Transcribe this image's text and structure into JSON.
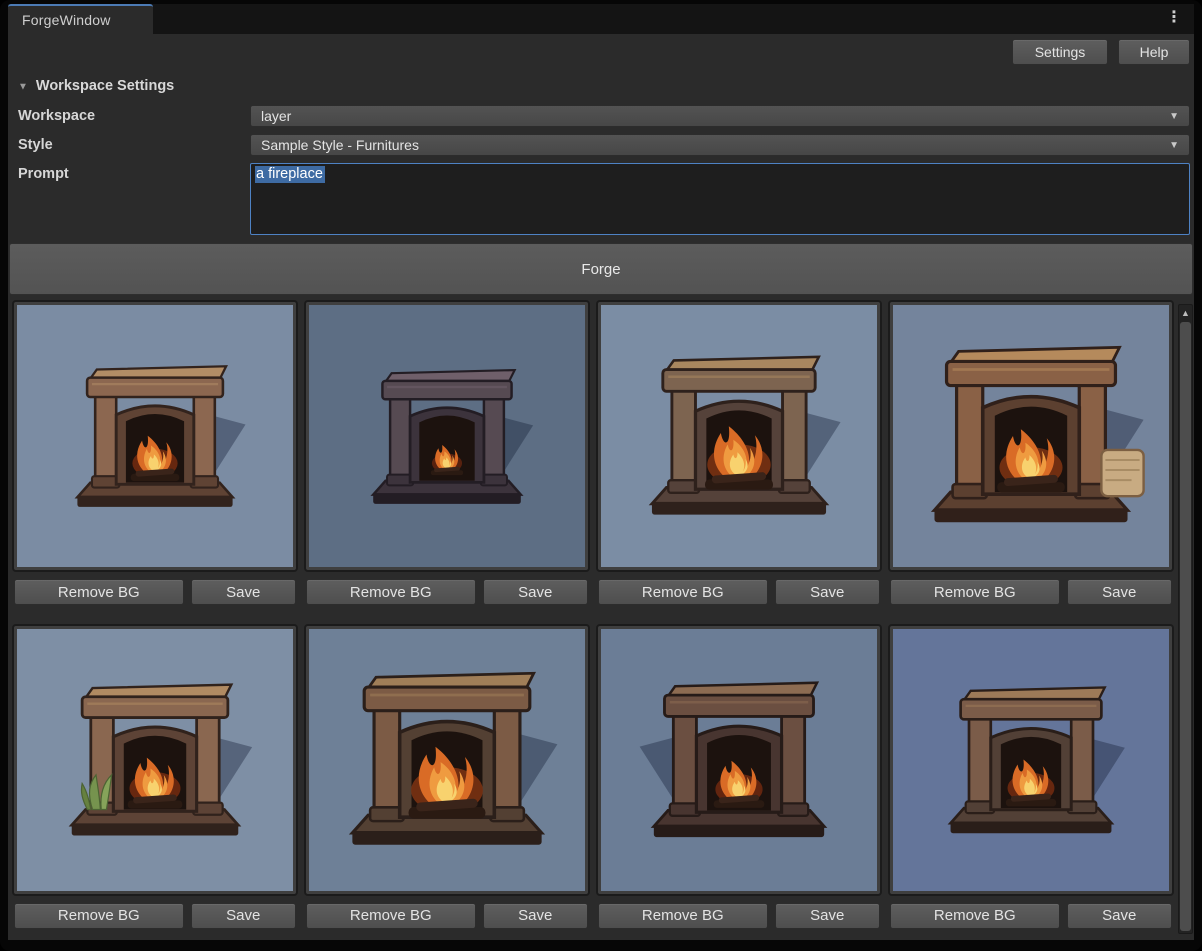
{
  "tab": {
    "title": "ForgeWindow"
  },
  "icons": {
    "window_menu": "⋮",
    "foldout_arrow": "▼",
    "dropdown_arrow": "▼",
    "scroll_up": "▲"
  },
  "toolbar": {
    "settings": "Settings",
    "help": "Help"
  },
  "settings_panel": {
    "foldout_label": "Workspace Settings",
    "workspace_label": "Workspace",
    "workspace_value": "layer",
    "style_label": "Style",
    "style_value": "Sample Style - Furnitures",
    "prompt_label": "Prompt",
    "prompt_value": "a fireplace",
    "prompt_selection_color": "#3e6ba3",
    "focus_border_color": "#4e82c4"
  },
  "forge": {
    "label": "Forge"
  },
  "colors": {
    "window_bg": "#2b2b2b",
    "tab_accent_blue": "#4c7bb5",
    "button_gray": "#535353"
  },
  "gallery": {
    "remove_bg_label": "Remove BG",
    "save_label": "Save",
    "cards": [
      {
        "name": "fireplace-1",
        "bg": "#7b8ca3",
        "body": "#8c6750",
        "mid": "#5f4334",
        "dark": "#32231d",
        "light": "#b28d66",
        "fire": 1.0,
        "scale": 0.82,
        "shadow": "right",
        "plant": false,
        "scroll": false,
        "glow": "#702a10"
      },
      {
        "name": "fireplace-2",
        "bg": "#5d6e84",
        "body": "#564a52",
        "mid": "#3c333c",
        "dark": "#231d24",
        "light": "#6f5f6a",
        "fire": 0.7,
        "scale": 0.78,
        "shadow": "right",
        "plant": false,
        "scroll": false,
        "glow": "#5e2310"
      },
      {
        "name": "fireplace-3",
        "bg": "#7b8da4",
        "body": "#7d6450",
        "mid": "#55423a",
        "dark": "#2e211c",
        "light": "#a9875f",
        "fire": 1.25,
        "scale": 0.92,
        "shadow": "right",
        "plant": false,
        "scroll": false,
        "glow": "#7a3212"
      },
      {
        "name": "fireplace-4",
        "bg": "#74849c",
        "body": "#8a6146",
        "mid": "#5c4030",
        "dark": "#30201a",
        "light": "#b58a5c",
        "fire": 1.12,
        "scale": 1.02,
        "shadow": "right",
        "plant": false,
        "scroll": true,
        "glow": "#7a3212"
      },
      {
        "name": "fireplace-5",
        "bg": "#7e8fa5",
        "body": "#8a6750",
        "mid": "#5d4336",
        "dark": "#30221c",
        "light": "#b08a62",
        "fire": 1.05,
        "scale": 0.88,
        "shadow": "right",
        "plant": true,
        "scroll": false,
        "glow": "#702a10"
      },
      {
        "name": "fireplace-6",
        "bg": "#6e8097",
        "body": "#7c5b45",
        "mid": "#534033",
        "dark": "#2b1f1a",
        "light": "#a07e58",
        "fire": 1.3,
        "scale": 1.0,
        "shadow": "right",
        "plant": false,
        "scroll": false,
        "glow": "#7a3212"
      },
      {
        "name": "fireplace-7",
        "bg": "#6b7d96",
        "body": "#6b4f41",
        "mid": "#483530",
        "dark": "#261b18",
        "light": "#8d6c52",
        "fire": 0.95,
        "scale": 0.9,
        "shadow": "left",
        "plant": false,
        "scroll": false,
        "glow": "#6b2810"
      },
      {
        "name": "fireplace-8",
        "bg": "#64759a",
        "body": "#7b5c49",
        "mid": "#524036",
        "dark": "#2a1e19",
        "light": "#9d7a58",
        "fire": 1.0,
        "scale": 0.85,
        "shadow": "right",
        "plant": false,
        "scroll": false,
        "glow": "#702a10"
      }
    ]
  }
}
